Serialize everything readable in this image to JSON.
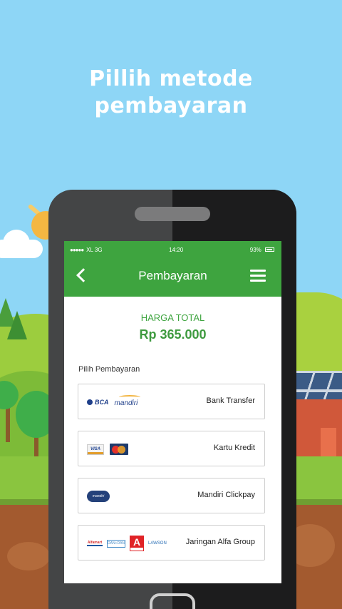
{
  "headline": {
    "line1": "Pillih metode",
    "line2": "pembayaran"
  },
  "status_bar": {
    "carrier": "XL 3G",
    "time": "14:20",
    "battery": "93%"
  },
  "app_bar": {
    "title": "Pembayaran",
    "back_icon": "chevron-left-icon",
    "menu_icon": "hamburger-menu-icon"
  },
  "price": {
    "label": "HARGA TOTAL",
    "value": "Rp 365.000"
  },
  "payment": {
    "section_label": "Pilih Pembayaran",
    "options": [
      {
        "label": "Bank Transfer",
        "logos": [
          "BCA",
          "mandiri"
        ]
      },
      {
        "label": "Kartu Kredit",
        "logos": [
          "VISA",
          "MasterCard"
        ]
      },
      {
        "label": "Mandiri Clickpay",
        "logos": [
          "mandiri"
        ]
      },
      {
        "label": "Jaringan Alfa Group",
        "logos": [
          "Alfamart",
          "DAN+DAN",
          "Alfamidi",
          "LAWSON"
        ]
      }
    ]
  },
  "colors": {
    "primary_green": "#3ea43f",
    "sky": "#8ed6f6",
    "phone_body": "#444546"
  }
}
